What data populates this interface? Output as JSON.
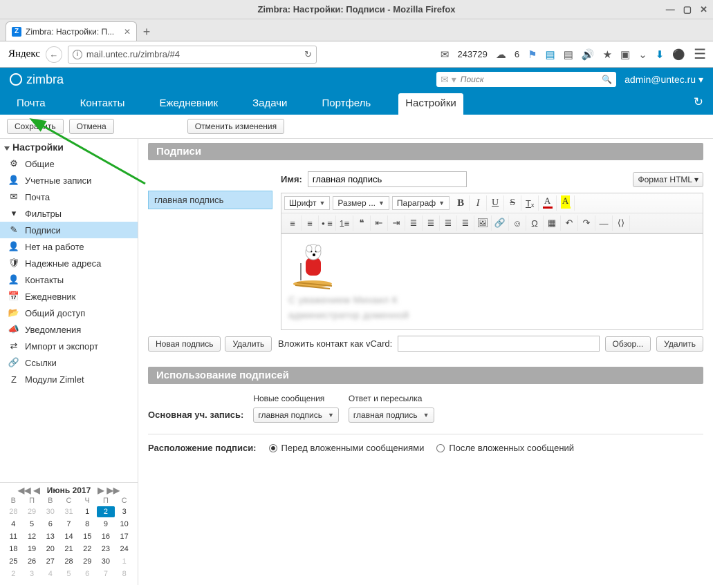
{
  "window": {
    "title": "Zimbra: Настройки: Подписи - Mozilla Firefox"
  },
  "browser_tab": {
    "label": "Zimbra: Настройки: П..."
  },
  "toolbar": {
    "yandex": "Яндекс",
    "url": "mail.untec.ru/zimbra/#4",
    "mail_count": "243729",
    "temp": "6"
  },
  "zimbra": {
    "search_placeholder": "Поиск",
    "user": "admin@untec.ru ▾"
  },
  "tabs": {
    "mail": "Почта",
    "contacts": "Контакты",
    "calendar": "Ежедневник",
    "tasks": "Задачи",
    "briefcase": "Портфель",
    "settings": "Настройки"
  },
  "actions": {
    "save": "Сохранить",
    "cancel": "Отмена",
    "undo": "Отменить изменения"
  },
  "sidebar": {
    "title": "Настройки",
    "items": [
      {
        "label": "Общие",
        "ico": "⚙"
      },
      {
        "label": "Учетные записи",
        "ico": "👤"
      },
      {
        "label": "Почта",
        "ico": "✉"
      },
      {
        "label": "Фильтры",
        "ico": "▾"
      },
      {
        "label": "Подписи",
        "ico": "✎"
      },
      {
        "label": "Нет на работе",
        "ico": "👤"
      },
      {
        "label": "Надежные адреса",
        "ico": "🛡"
      },
      {
        "label": "Контакты",
        "ico": "👤"
      },
      {
        "label": "Ежедневник",
        "ico": "📅"
      },
      {
        "label": "Общий доступ",
        "ico": "📂"
      },
      {
        "label": "Уведомления",
        "ico": "📣"
      },
      {
        "label": "Импорт и экспорт",
        "ico": "⇄"
      },
      {
        "label": "Ссылки",
        "ico": "🔗"
      },
      {
        "label": "Модули Zimlet",
        "ico": "Z"
      }
    ],
    "active_index": 4
  },
  "signatures": {
    "panel_title": "Подписи",
    "name_label": "Имя:",
    "name_value": "главная подпись",
    "list_item": "главная подпись",
    "format_label": "Формат HTML ▾",
    "editor_fontsel": "Шрифт",
    "editor_sizesel": "Размер ...",
    "editor_parasel": "Параграф",
    "blur1": "С уважением Михаил К",
    "blur2": "администратор доменной",
    "new_sig": "Новая подпись",
    "delete": "Удалить",
    "vcard_label": "Вложить контакт как vCard:",
    "browse": "Обзор...",
    "delete2": "Удалить"
  },
  "usage": {
    "panel_title": "Использование подписей",
    "new_msg": "Новые сообщения",
    "reply": "Ответ и пересылка",
    "primary_label": "Основная уч. запись:",
    "sel_value": "главная подпись"
  },
  "placement": {
    "label": "Расположение подписи:",
    "before": "Перед вложенными сообщениями",
    "after": "После вложенных сообщений"
  },
  "calendar": {
    "month": "Июнь 2017",
    "dow": [
      "В",
      "П",
      "В",
      "С",
      "Ч",
      "П",
      "С"
    ],
    "prev": [
      "28",
      "29",
      "30",
      "31"
    ],
    "days": [
      "1",
      "2",
      "3",
      "4",
      "5",
      "6",
      "7",
      "8",
      "9",
      "10",
      "11",
      "12",
      "13",
      "14",
      "15",
      "16",
      "17",
      "18",
      "19",
      "20",
      "21",
      "22",
      "23",
      "24",
      "25",
      "26",
      "27",
      "28",
      "29",
      "30"
    ],
    "next": [
      "1",
      "2",
      "3",
      "4",
      "5",
      "6",
      "7",
      "8"
    ],
    "active_day": "2"
  }
}
